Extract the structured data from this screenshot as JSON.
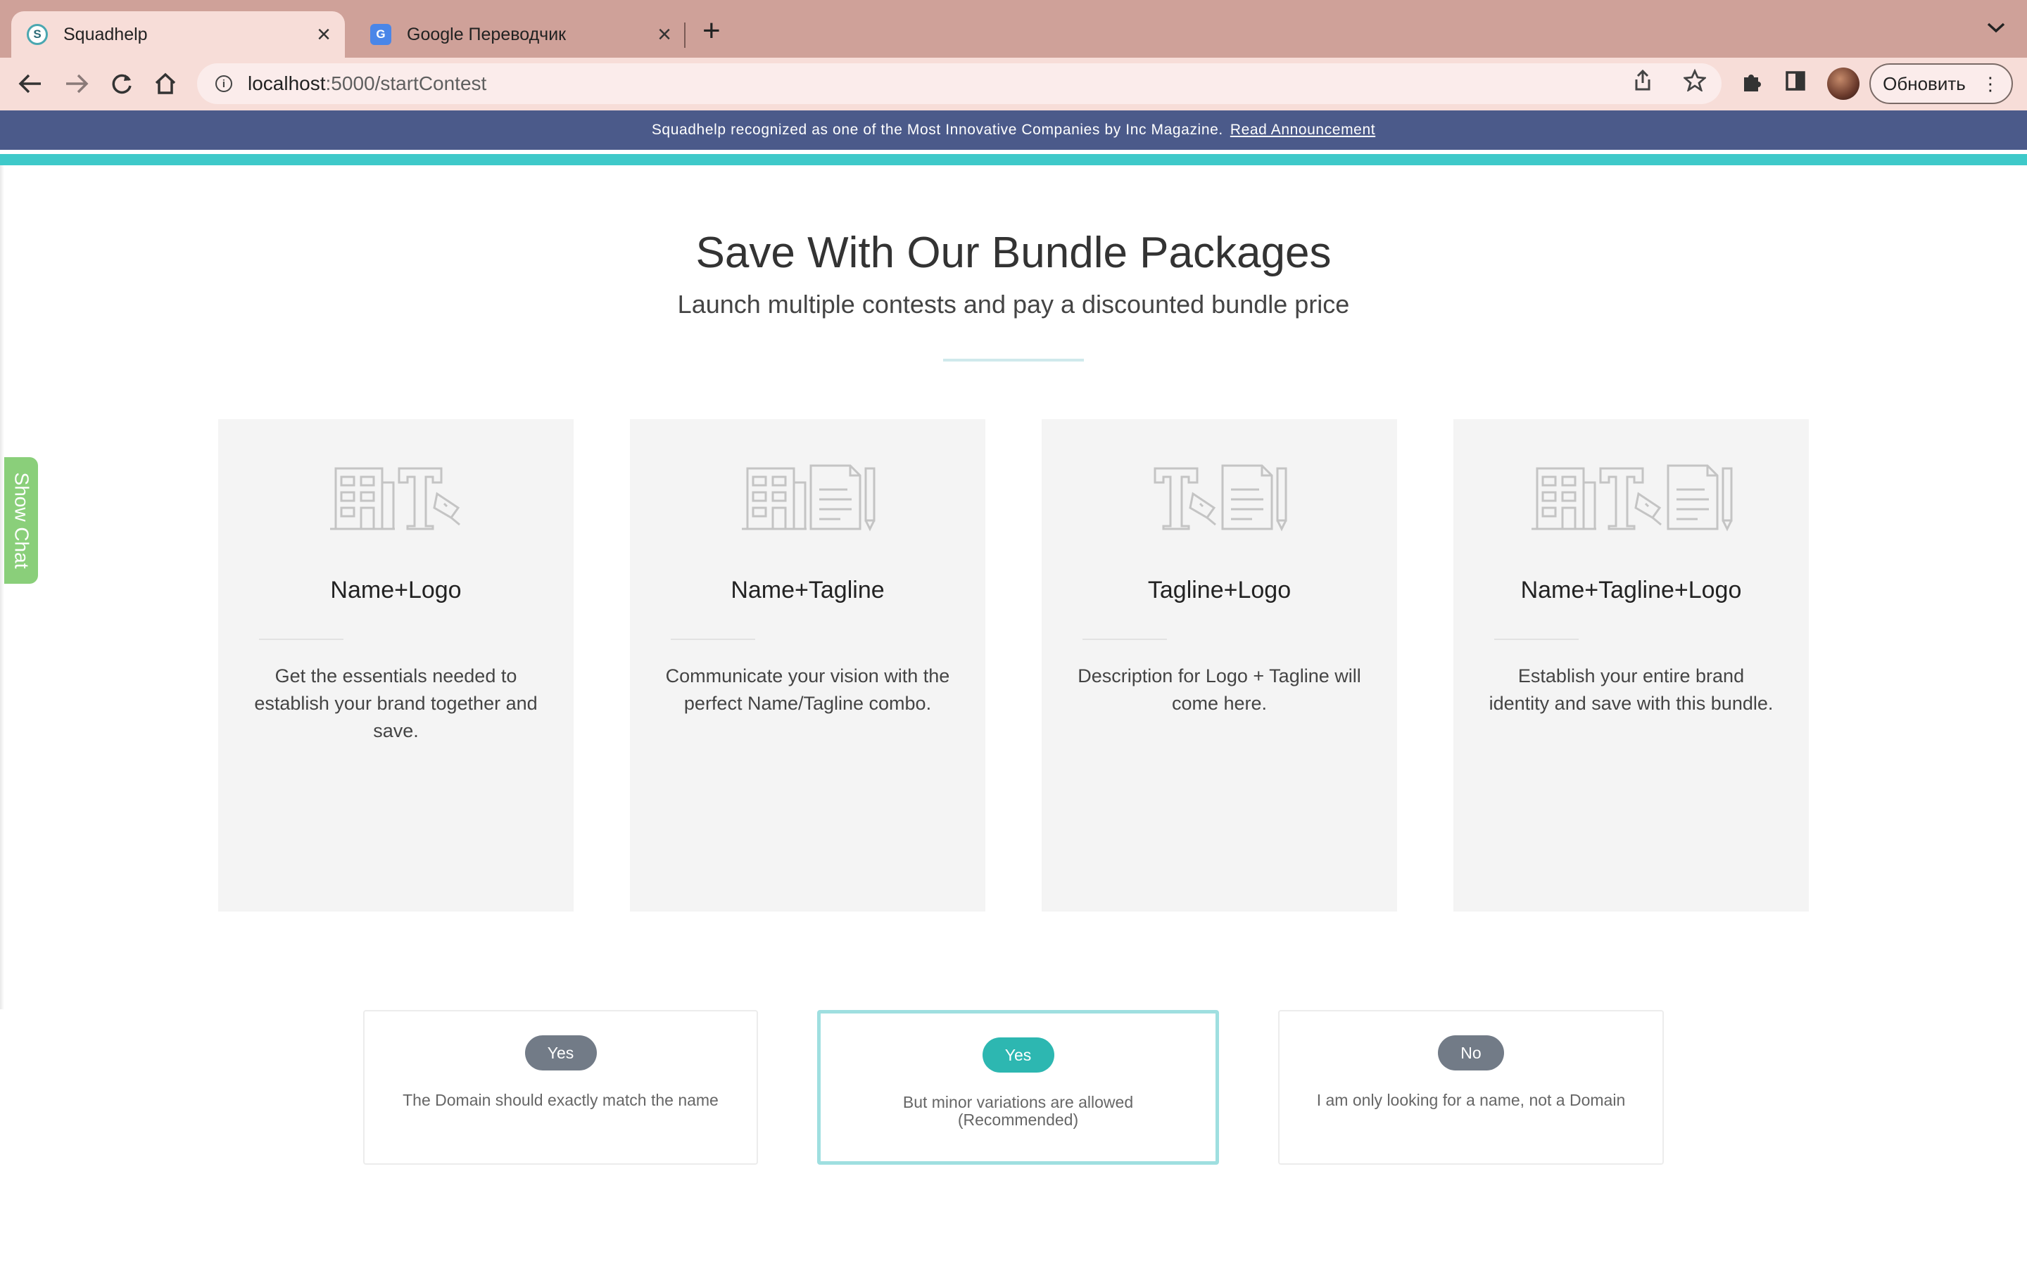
{
  "browser": {
    "tabs": [
      {
        "title": "Squadhelp",
        "favicon": "squadhelp-favicon",
        "active": true
      },
      {
        "title": "Google Переводчик",
        "favicon": "google-translate-favicon",
        "active": false
      }
    ],
    "url_host": "localhost",
    "url_path": ":5000/startContest",
    "update_button_label": "Обновить"
  },
  "announcement": {
    "text": "Squadhelp recognized as one of the Most Innovative Companies by Inc Magazine.",
    "link_label": "Read Announcement"
  },
  "chat_tab_label": "Show Chat",
  "section": {
    "title": "Save With Our Bundle Packages",
    "subtitle": "Launch multiple contests and pay a discounted bundle price"
  },
  "bundles": [
    {
      "title": "Name+Logo",
      "description": "Get the essentials needed to establish your brand together and save.",
      "icons": [
        "building-icon",
        "logo-pen-icon"
      ]
    },
    {
      "title": "Name+Tagline",
      "description": "Communicate your vision with the perfect Name/Tagline combo.",
      "icons": [
        "building-icon",
        "document-pencil-icon"
      ]
    },
    {
      "title": "Tagline+Logo",
      "description": "Description for Logo + Tagline will come here.",
      "icons": [
        "logo-pen-icon",
        "document-pencil-icon"
      ]
    },
    {
      "title": "Name+Tagline+Logo",
      "description": "Establish your entire brand identity and save with this bundle.",
      "icons": [
        "building-icon",
        "logo-pen-icon",
        "document-pencil-icon"
      ]
    }
  ],
  "domain_options": [
    {
      "badge": "Yes",
      "text": "The Domain should exactly match the name",
      "selected": false
    },
    {
      "badge": "Yes",
      "text": "But minor variations are allowed (Recommended)",
      "selected": true
    },
    {
      "badge": "No",
      "text": "I am only looking for a name, not a Domain",
      "selected": false
    }
  ],
  "colors": {
    "announcement_bg": "#4b5a8a",
    "accent_teal": "#3ec9c9",
    "badge_grey": "#727b87",
    "badge_teal": "#2db7b1",
    "selected_border": "#9fdfe0",
    "chat_tab": "#8acf7a"
  }
}
